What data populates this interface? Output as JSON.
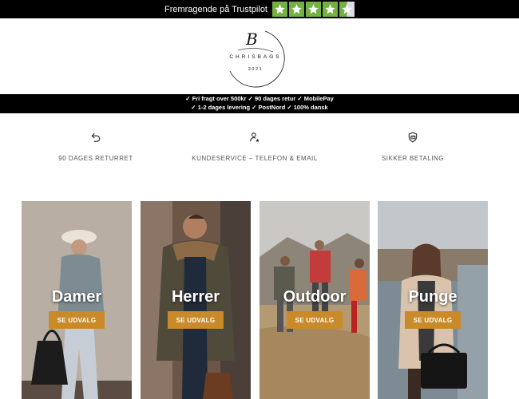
{
  "trustpilot": {
    "text": "Fremragende på Trustpilot",
    "rating": 4.5,
    "star_color": "#73b143"
  },
  "logo": {
    "mark": "B",
    "name": "CHRISBAGS",
    "year": "2021"
  },
  "benefits": {
    "line1": "✓ Fri fragt over 500kr ✓ 90 dages retur ✓ MobilePay",
    "line2": "✓ 1-2 dages levering ✓ PostNord ✓ 100% dansk"
  },
  "features": [
    {
      "icon": "return-arrow-icon",
      "label": "90 DAGES RETURRET"
    },
    {
      "icon": "customer-service-icon",
      "label": "KUNDESERVICE – TELEFON & EMAIL"
    },
    {
      "icon": "secure-payment-icon",
      "label": "SIKKER BETALING"
    }
  ],
  "categories": [
    {
      "title": "Damer",
      "button": "SE UDVALG"
    },
    {
      "title": "Herrer",
      "button": "SE UDVALG"
    },
    {
      "title": "Outdoor",
      "button": "SE UDVALG"
    },
    {
      "title": "Punge",
      "button": "SE UDVALG"
    }
  ],
  "colors": {
    "accent_button": "#c98a2a",
    "bar_background": "#000000"
  }
}
